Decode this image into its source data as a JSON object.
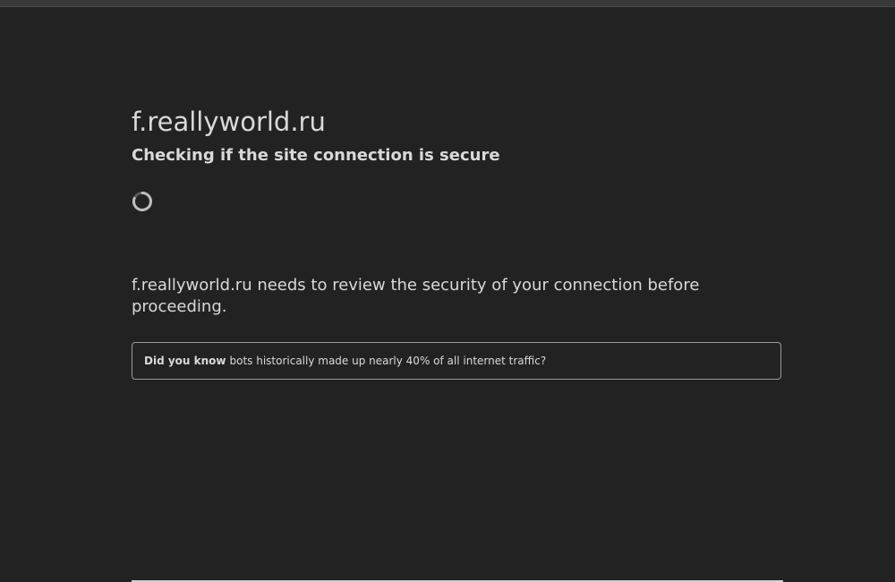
{
  "page": {
    "site_name": "f.reallyworld.ru",
    "heading": "Checking if the site connection is secure",
    "spinner_icon": "loading-spinner-icon",
    "review_message": "f.reallyworld.ru needs to review the security of your connection before proceeding.",
    "tip": {
      "label": "Did you know",
      "text": "bots historically made up nearly 40% of all internet traffic?"
    }
  },
  "colors": {
    "background": "#222222",
    "text": "#d9d9d9",
    "border": "#9a9a9a"
  }
}
